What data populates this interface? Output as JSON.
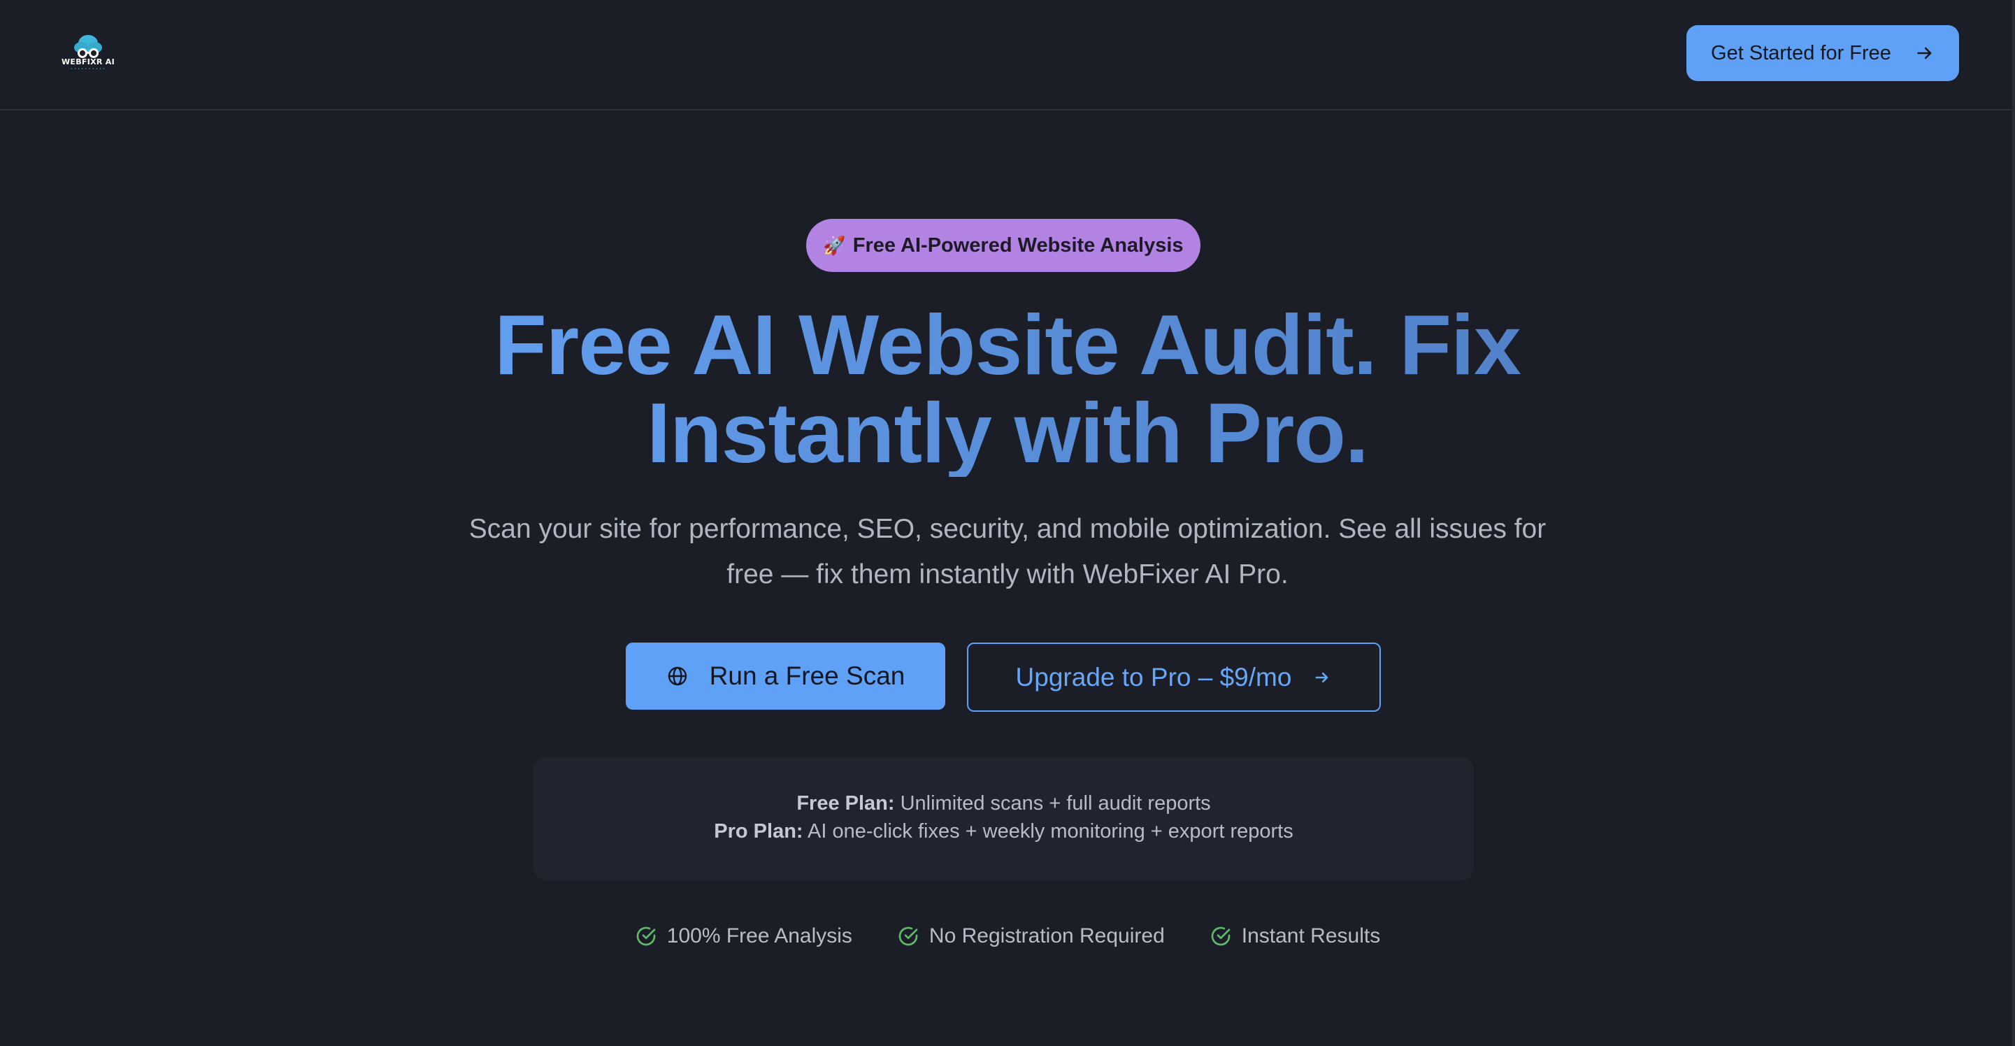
{
  "header": {
    "logo_text": "WEBFIXR AI",
    "cta_label": "Get Started for Free"
  },
  "hero": {
    "badge_icon": "🚀",
    "badge_text": "Free AI-Powered Website Analysis",
    "headline_line1": "Free AI Website Audit. Fix",
    "headline_line2": "Instantly with Pro.",
    "subtitle_line1": "Scan your site for performance, SEO, security, and mobile optimization. See all issues for",
    "subtitle_line2": "free — fix them instantly with WebFixer AI Pro.",
    "primary_button": "Run a Free Scan",
    "secondary_button": "Upgrade to Pro – $9/mo"
  },
  "plans": {
    "free_label": "Free Plan:",
    "free_text": " Unlimited scans + full audit reports",
    "pro_label": "Pro Plan:",
    "pro_text": " AI one-click fixes + weekly monitoring + export reports"
  },
  "features": [
    {
      "label": "100% Free Analysis",
      "icon": "check-circle-icon"
    },
    {
      "label": "No Registration Required",
      "icon": "check-circle-icon"
    },
    {
      "label": "Instant Results",
      "icon": "check-circle-icon"
    }
  ],
  "colors": {
    "background": "#1b1e27",
    "accent": "#5ea1f6",
    "badge": "#b383e4",
    "check": "#5dbb6b"
  }
}
